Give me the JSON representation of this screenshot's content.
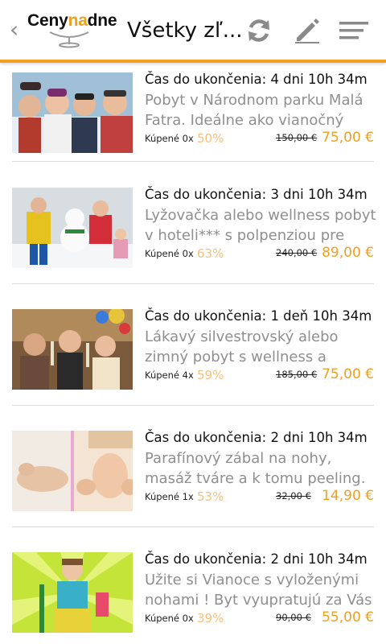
{
  "header": {
    "back_icon": "chevron-left-icon",
    "logo": {
      "part1": "Ceny",
      "part2": "na",
      "part3": "dne"
    },
    "title": "Všetky zľ...",
    "icons": [
      "refresh-icon",
      "pencil-icon",
      "menu-icon"
    ],
    "accent_color": "#f0a01e"
  },
  "deals": [
    {
      "time_left": "Čas do ukončenia: 4 dni 10h 34m",
      "description": "Pobyt v Národnom parku Malá Fatra. Ideálne ako vianočný",
      "bought": "Kúpené 0x",
      "discount": "50%",
      "old_price": "150,00 €",
      "price": "75,00 €"
    },
    {
      "time_left": "Čas do ukončenia: 3 dni 10h 34m",
      "description": "Lyžovačka alebo wellness pobyt v hoteli*** s polpenziou pre",
      "bought": "Kúpené 0x",
      "discount": "63%",
      "old_price": "240,00 €",
      "price": "89,00 €"
    },
    {
      "time_left": "Čas do ukončenia: 1 deň 10h 34m",
      "description": "Lákavý silvestrovský alebo zimný pobyt s wellness a",
      "bought": "Kúpené 4x",
      "discount": "59%",
      "old_price": "185,00 €",
      "price": "75,00 €"
    },
    {
      "time_left": "Čas do ukončenia: 2 dni 10h 34m",
      "description": "Parafínový zábal na nohy, masáž tváre a k tomu peeling.",
      "bought": "Kúpené 1x",
      "discount": "53%",
      "old_price": "32,00 €",
      "price": "14,90 €"
    },
    {
      "time_left": "Čas do ukončenia: 2 dni 10h 34m",
      "description": "Užite si Vianoce s vyloženými nohami ! Byt vyupratujú za Vás",
      "bought": "Kúpené 0x",
      "discount": "39%",
      "old_price": "90,00 €",
      "price": "55,00 €"
    }
  ]
}
